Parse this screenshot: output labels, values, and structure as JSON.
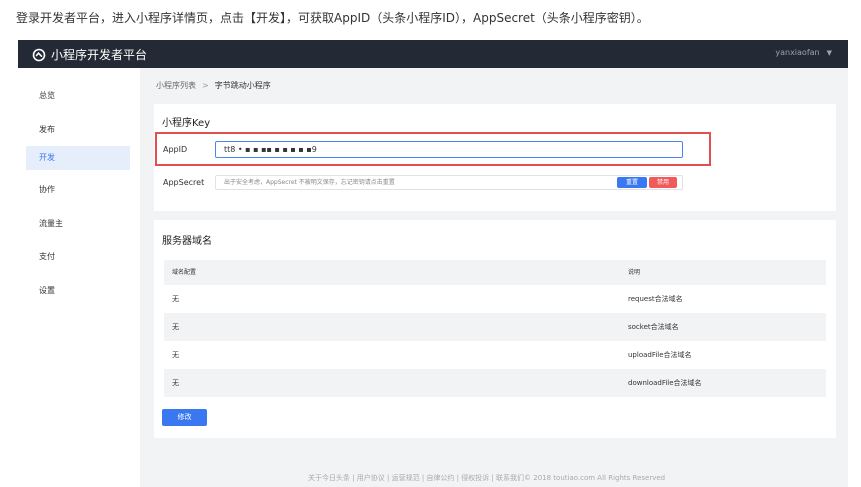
{
  "instruction": "登录开发者平台，进入小程序详情页，点击【开发】，可获取AppID（头条小程序ID），AppSecret（头条小程序密钥）。",
  "header": {
    "title": "小程序开发者平台",
    "user": "yanxiaofan",
    "logo_icon": "loop-logo-icon",
    "caret_icon": "chevron-down-icon"
  },
  "sidebar": {
    "items": [
      {
        "label": "总览"
      },
      {
        "label": "发布"
      },
      {
        "label": "开发",
        "active": true
      },
      {
        "label": "协作"
      },
      {
        "label": "流量主"
      },
      {
        "label": "支付"
      },
      {
        "label": "设置"
      }
    ]
  },
  "breadcrumb": {
    "parent": "小程序列表",
    "separator": ">",
    "current": "字节跳动小程序"
  },
  "key_card": {
    "title": "小程序Key",
    "appid_label": "AppID",
    "appid_value": "tt8 • ▪ ▪ ▪▪ ▪ ▪ ▪ ▪ ▪9",
    "secret_label": "AppSecret",
    "secret_placeholder": "出于安全考虑，AppSecret 不被明文保存，忘记密钥请点击重置",
    "reset_label": "重置",
    "disable_label": "禁用"
  },
  "domain_card": {
    "title": "服务器域名",
    "columns": [
      "域名配置",
      "说明"
    ],
    "rows": [
      {
        "value": "无",
        "desc": "request合法域名"
      },
      {
        "value": "无",
        "desc": "socket合法域名"
      },
      {
        "value": "无",
        "desc": "uploadFile合法域名"
      },
      {
        "value": "无",
        "desc": "downloadFile合法域名"
      }
    ],
    "edit_label": "修改"
  },
  "footer": "关于今日头条 | 用户协议 | 运营规范 | 自律公约 | 侵权投诉 | 联系我们© 2018 toutiao.com All Rights Reserved",
  "colors": {
    "topbar": "#232a35",
    "accent": "#3a78f2",
    "danger": "#f05a5a",
    "highlight": "#e05050"
  }
}
